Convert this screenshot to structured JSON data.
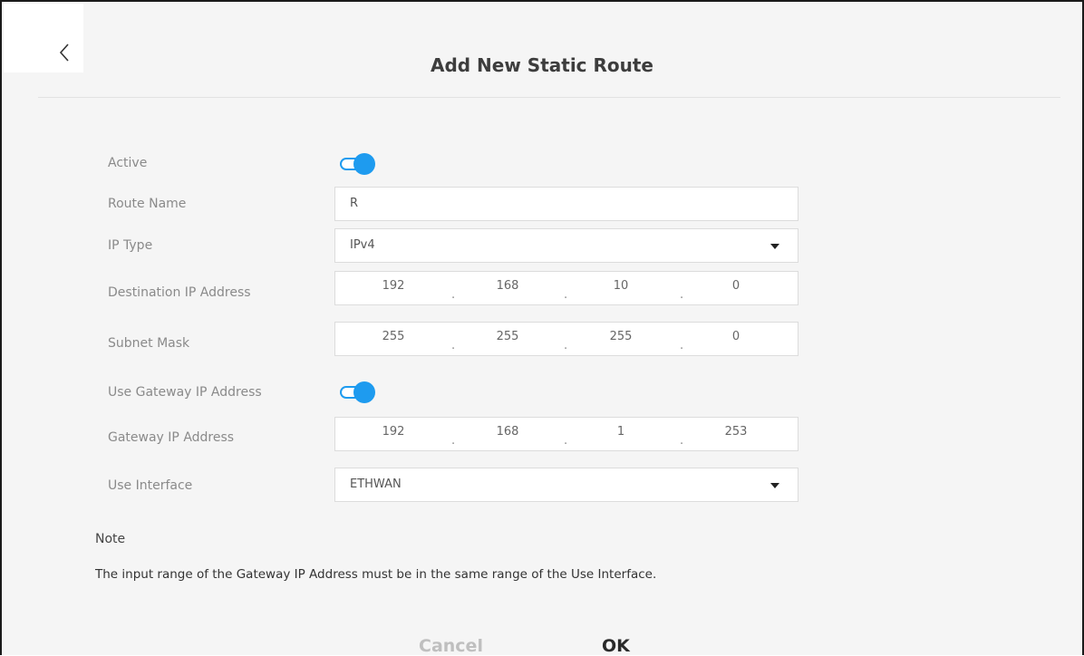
{
  "header": {
    "title": "Add New Static Route"
  },
  "form": {
    "active": {
      "label": "Active",
      "on": true
    },
    "route_name": {
      "label": "Route Name",
      "value": "R"
    },
    "ip_type": {
      "label": "IP Type",
      "value": "IPv4"
    },
    "destination_ip": {
      "label": "Destination IP Address",
      "octets": [
        "192",
        "168",
        "10",
        "0"
      ]
    },
    "subnet_mask": {
      "label": "Subnet Mask",
      "octets": [
        "255",
        "255",
        "255",
        "0"
      ]
    },
    "use_gateway": {
      "label": "Use Gateway IP Address",
      "on": true
    },
    "gateway_ip": {
      "label": "Gateway IP Address",
      "octets": [
        "192",
        "168",
        "1",
        "253"
      ]
    },
    "use_interface": {
      "label": "Use Interface",
      "value": "ETHWAN"
    }
  },
  "note": {
    "title": "Note",
    "text": "The input range of the Gateway IP Address must be in the same range of the Use Interface."
  },
  "buttons": {
    "cancel": "Cancel",
    "ok": "OK"
  },
  "icons": {
    "back": "chevron-left-icon",
    "dropdown": "caret-down-icon"
  },
  "colors": {
    "accent": "#1e9bef",
    "ok_highlight": "#f5c518"
  }
}
